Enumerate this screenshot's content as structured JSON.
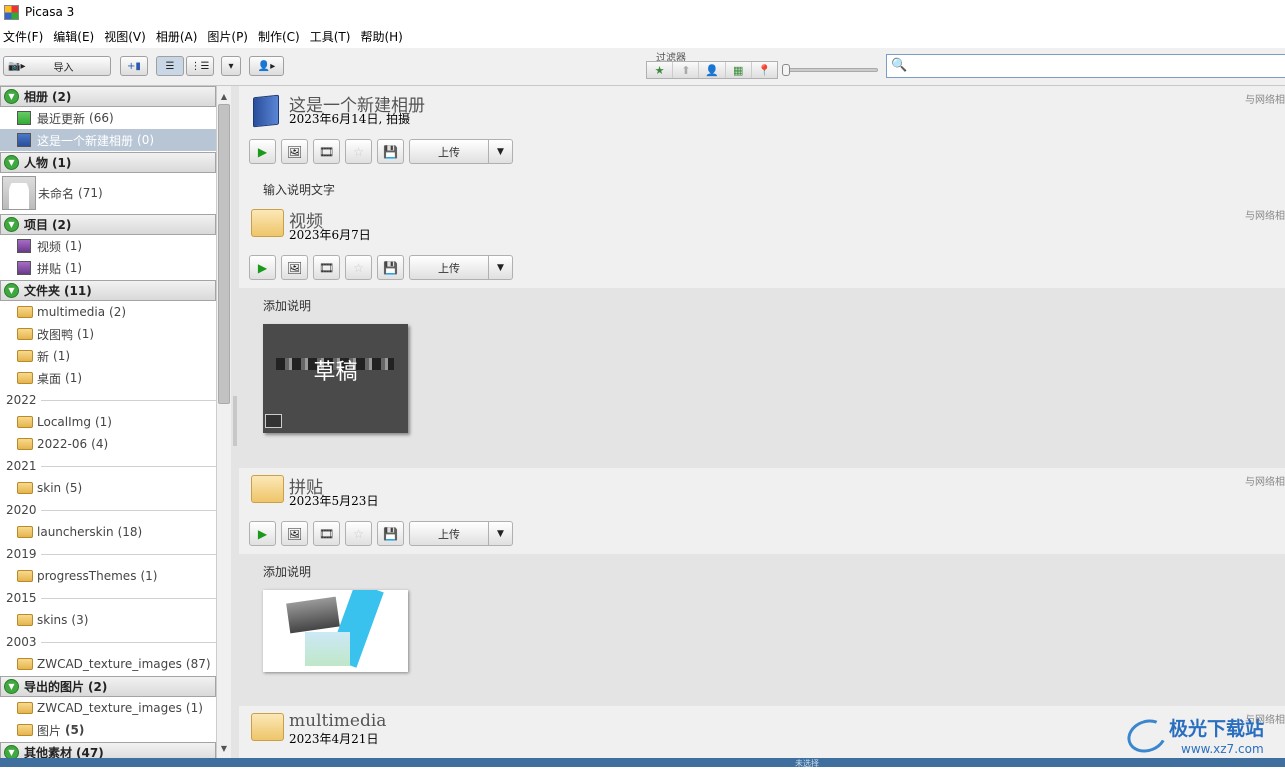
{
  "window": {
    "title": "Picasa 3"
  },
  "menu": [
    "文件(F)",
    "编辑(E)",
    "视图(V)",
    "相册(A)",
    "图片(P)",
    "制作(C)",
    "工具(T)",
    "帮助(H)"
  ],
  "toolbar": {
    "import_label": "导入",
    "filter_label": "过滤器",
    "search_placeholder": ""
  },
  "sidebar": {
    "sections": {
      "albums": {
        "label": "相册",
        "count": "(2)"
      },
      "people": {
        "label": "人物",
        "count": "(1)"
      },
      "projects": {
        "label": "项目",
        "count": "(2)"
      },
      "folders": {
        "label": "文件夹",
        "count": "(11)"
      },
      "exported": {
        "label": "导出的图片",
        "count": "(2)"
      },
      "other": {
        "label": "其他素材",
        "count": "(47)"
      }
    },
    "albums": [
      {
        "label": "最近更新",
        "count": "(66)"
      },
      {
        "label": "这是一个新建相册",
        "count": "(0)"
      }
    ],
    "people": [
      {
        "label": "未命名",
        "count": "(71)"
      }
    ],
    "projects": [
      {
        "label": "视频",
        "count": "(1)"
      },
      {
        "label": "拼贴",
        "count": "(1)"
      }
    ],
    "folders": [
      {
        "label": "multimedia",
        "count": "(2)"
      },
      {
        "label": "改图鸭",
        "count": "(1)"
      },
      {
        "label": "新",
        "count": "(1)"
      },
      {
        "label": "桌面",
        "count": "(1)"
      }
    ],
    "years": [
      "2022",
      "2021",
      "2020",
      "2019",
      "2015",
      "2003"
    ],
    "y2022": [
      {
        "label": "LocalImg",
        "count": "(1)"
      },
      {
        "label": "2022-06",
        "count": "(4)"
      }
    ],
    "y2021": [
      {
        "label": "skin",
        "count": "(5)"
      }
    ],
    "y2020": [
      {
        "label": "launcherskin",
        "count": "(18)"
      }
    ],
    "y2019": [
      {
        "label": "progressThemes",
        "count": "(1)"
      }
    ],
    "y2015": [
      {
        "label": "skins",
        "count": "(3)"
      }
    ],
    "y2003": [
      {
        "label": "ZWCAD_texture_images",
        "count": "(87)"
      }
    ],
    "exported": [
      {
        "label": "ZWCAD_texture_images",
        "count": "(1)"
      },
      {
        "label": "图片",
        "count": "(5)"
      }
    ]
  },
  "main": {
    "albums": [
      {
        "title": "这是一个新建相册",
        "date": "2023年6月14日, 拍摄",
        "caption": "输入说明文字",
        "net": "与网络相",
        "upload": "上传"
      },
      {
        "title": "视频",
        "date": "2023年6月7日",
        "caption": "添加说明",
        "net": "与网络相",
        "upload": "上传",
        "thumb_label": "草稿"
      },
      {
        "title": "拼贴",
        "date": "2023年5月23日",
        "caption": "添加说明",
        "net": "与网络相",
        "upload": "上传"
      },
      {
        "title": "multimedia",
        "date": "2023年4月21日",
        "net": "与网络相"
      }
    ]
  },
  "status": {
    "text": "未选择"
  },
  "watermark": {
    "line1": "极光下载站",
    "line2": "www.xz7.com"
  }
}
